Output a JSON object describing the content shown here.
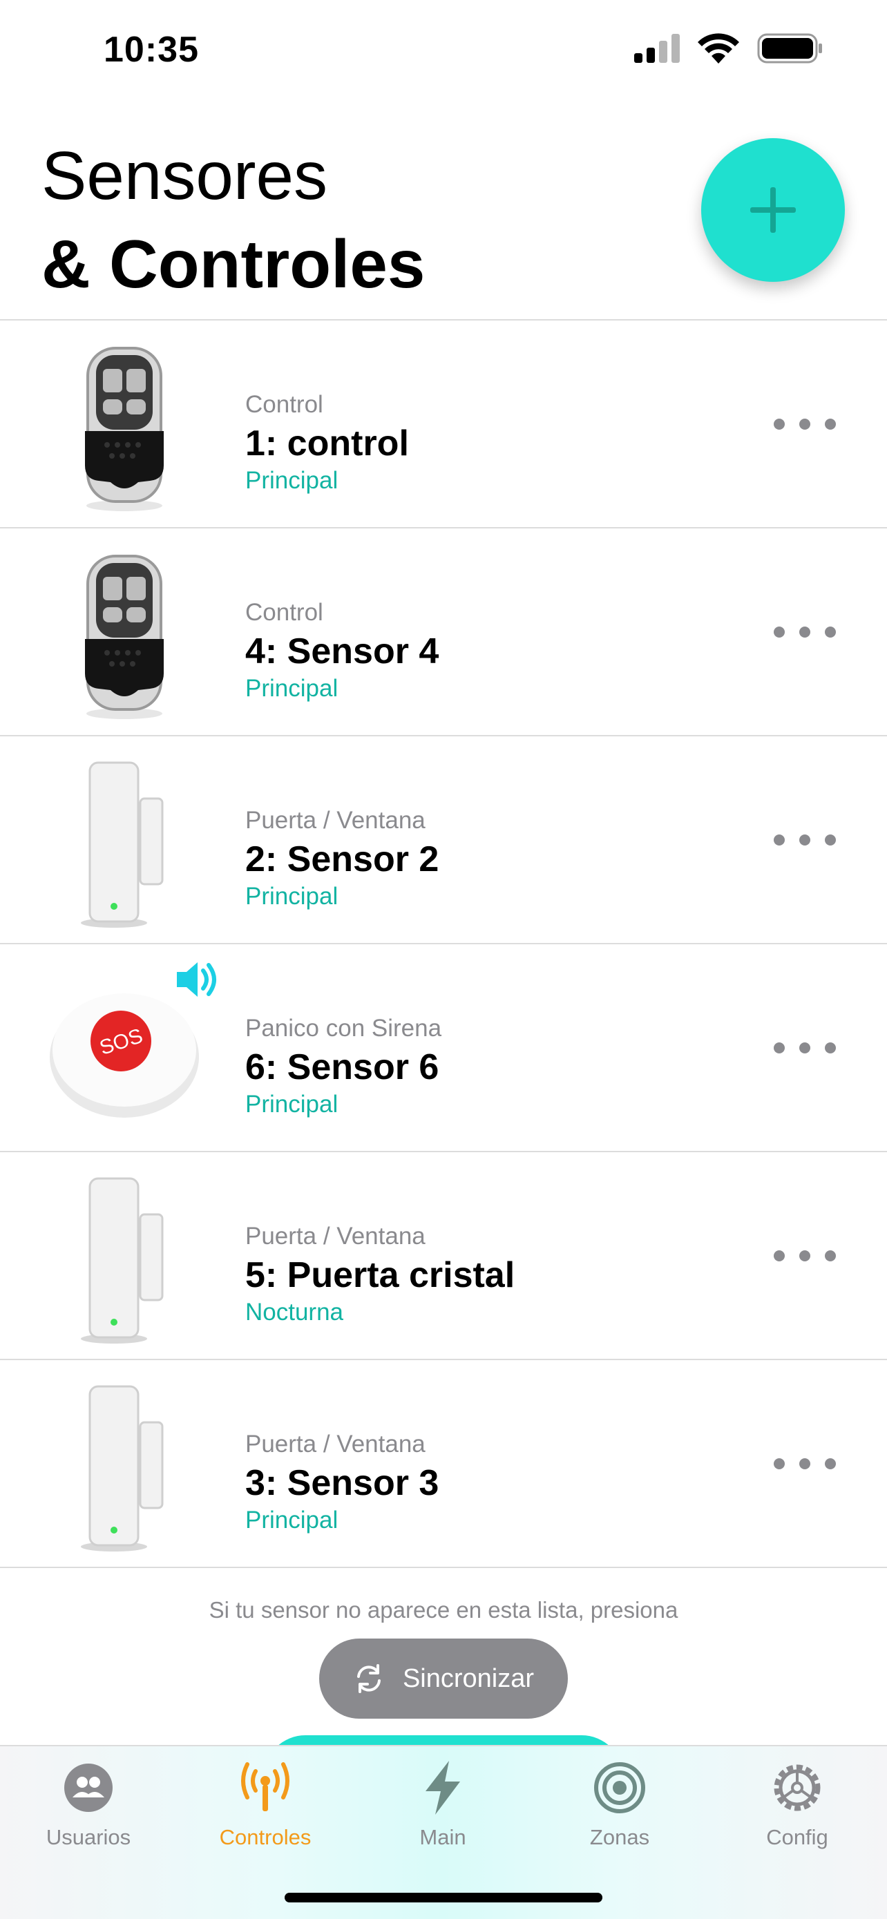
{
  "status_bar": {
    "time": "10:35"
  },
  "header": {
    "title_line1": "Sensores",
    "title_line2": "& Controles"
  },
  "colors": {
    "accent": "#1fe0cf",
    "mode_text": "#12b3a2",
    "active_tab": "#f39a1a",
    "muted": "#8a8a8e",
    "siren_icon": "#1ccfe4"
  },
  "sensors": [
    {
      "type": "Control",
      "name": "1: control",
      "mode": "Principal",
      "image": "key-fob-remote"
    },
    {
      "type": "Control",
      "name": "4: Sensor 4",
      "mode": "Principal",
      "image": "key-fob-remote"
    },
    {
      "type": "Puerta / Ventana",
      "name": "2: Sensor 2",
      "mode": "Principal",
      "image": "door-window-sensor"
    },
    {
      "type": "Panico con Sirena",
      "name": "6: Sensor 6",
      "mode": "Principal",
      "image": "sos-panic-button",
      "badge": "speaker-icon"
    },
    {
      "type": "Puerta / Ventana",
      "name": "5: Puerta cristal",
      "mode": "Nocturna",
      "image": "door-window-sensor"
    },
    {
      "type": "Puerta / Ventana",
      "name": "3: Sensor 3",
      "mode": "Principal",
      "image": "door-window-sensor"
    }
  ],
  "sos_label": "SOS",
  "footer": {
    "hint": "Si tu sensor no aparece en esta lista, presiona",
    "sync_label": "Sincronizar"
  },
  "tabs": [
    {
      "label": "Usuarios",
      "icon": "users-icon"
    },
    {
      "label": "Controles",
      "icon": "antenna-icon",
      "active": true
    },
    {
      "label": "Main",
      "icon": "lightning-icon"
    },
    {
      "label": "Zonas",
      "icon": "target-icon"
    },
    {
      "label": "Config",
      "icon": "gear-icon"
    }
  ]
}
